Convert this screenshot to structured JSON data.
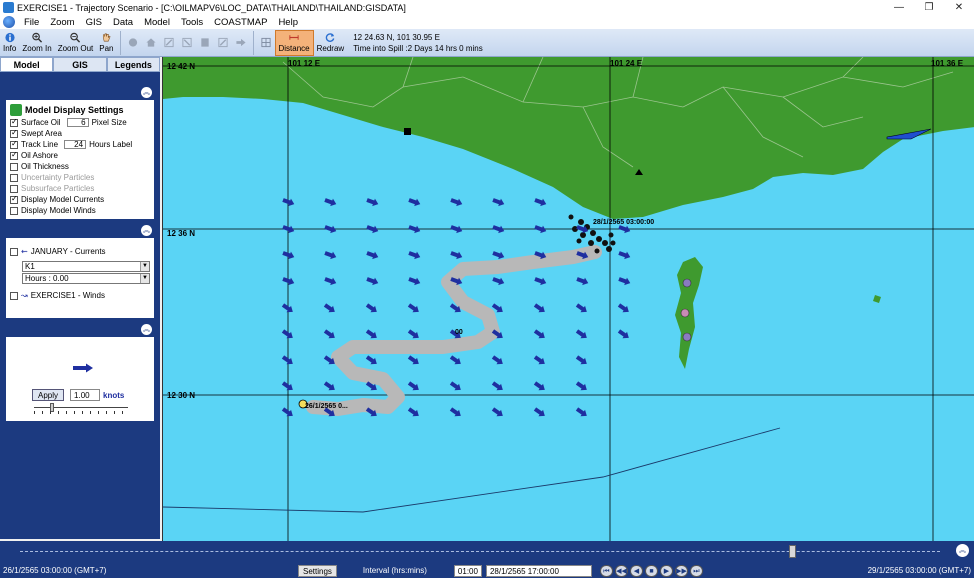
{
  "window": {
    "title": "EXERCISE1 - Trajectory Scenario - [C:\\OILMAPV6\\LOC_DATA\\THAILAND\\THAILAND:GISDATA]",
    "controls": [
      "—",
      "❐",
      "✕"
    ]
  },
  "menu": [
    "File",
    "Zoom",
    "GIS",
    "Data",
    "Model",
    "Tools",
    "COASTMAP",
    "Help"
  ],
  "toolbar": {
    "buttons": [
      {
        "label": "Info",
        "icon": "info-icon"
      },
      {
        "label": "Zoom In",
        "icon": "zoom-in-icon"
      },
      {
        "label": "Zoom Out",
        "icon": "zoom-out-icon"
      },
      {
        "label": "Pan",
        "icon": "pan-hand-icon"
      }
    ],
    "distance_label": "Distance",
    "redraw_label": "Redraw",
    "coords": "12 24.63 N,  101 30.95 E",
    "time_into_spill": "Time into Spill :2 Days 14 hrs 0 mins"
  },
  "left_panel": {
    "tabs": [
      "Model",
      "GIS",
      "Legends"
    ],
    "active_tab": "Model",
    "display_settings": {
      "title": "Model Display Settings",
      "items": [
        {
          "label": "Surface Oil",
          "checked": true,
          "value": "6",
          "suffix": "Pixel Size",
          "enabled": true
        },
        {
          "label": "Swept Area",
          "checked": true,
          "enabled": true
        },
        {
          "label": "Track Line",
          "checked": true,
          "value": "24",
          "suffix": "Hours Label",
          "enabled": true
        },
        {
          "label": "Oil Ashore",
          "checked": true,
          "enabled": true
        },
        {
          "label": "Oil Thickness",
          "checked": false,
          "enabled": true
        },
        {
          "label": "Uncertainty Particles",
          "checked": false,
          "enabled": false
        },
        {
          "label": "Subsurface Particles",
          "checked": false,
          "enabled": false
        },
        {
          "label": "Display Model Currents",
          "checked": true,
          "enabled": true
        },
        {
          "label": "Display Model Winds",
          "checked": false,
          "enabled": true
        }
      ]
    },
    "layers": {
      "currents_label": "JANUARY - Currents",
      "constituent": "K1",
      "hours": "Hours : 0.00",
      "winds_label": "EXERCISE1 - Winds"
    },
    "current_scale": {
      "apply_label": "Apply",
      "value": "1.00",
      "unit": "knots"
    }
  },
  "map": {
    "lat_labels": [
      "12 42 N",
      "12 36 N",
      "12 30 N"
    ],
    "lon_labels": [
      "101 12 E",
      "101 24 E",
      "101 36 E"
    ],
    "track_labels": [
      "28/1/2565 03:00:00",
      "26/1/2565 0...",
      "00"
    ],
    "colors": {
      "water": "#5ad4f5",
      "land": "#3f9a2f",
      "oil_track": "#b8b8b8",
      "oil_ashore": "#000000",
      "arrow": "#1f2fa0"
    }
  },
  "timeline": {
    "start": "26/1/2565 03:00:00 (GMT+7)",
    "settings_label": "Settings",
    "interval_label": "Interval (hrs:mins)",
    "interval": "01:00",
    "current_time": "28/1/2565 17:00:00",
    "end": "29/1/2565 03:00:00 (GMT+7)",
    "position_fraction": 0.84
  }
}
